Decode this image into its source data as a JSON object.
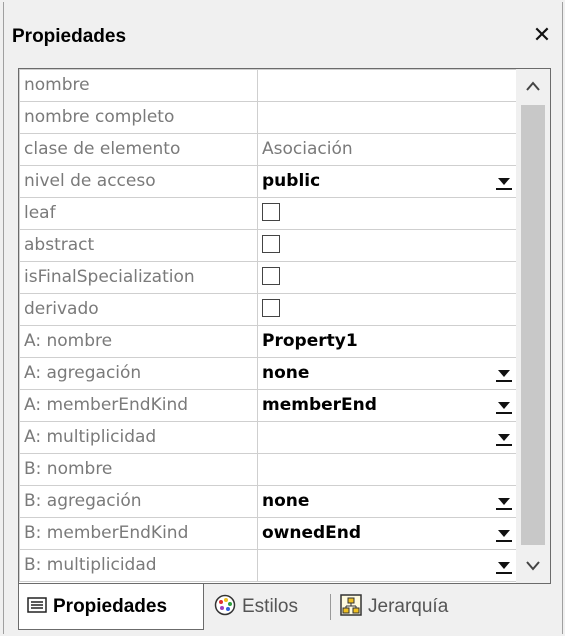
{
  "panel": {
    "title": "Propiedades",
    "close_glyph": "✕"
  },
  "properties": [
    {
      "name": "nombre",
      "value": "",
      "kind": "text"
    },
    {
      "name": "nombre completo",
      "value": "",
      "kind": "text"
    },
    {
      "name": "clase de elemento",
      "value": "Asociación",
      "kind": "readonly"
    },
    {
      "name": "nivel de acceso",
      "value": "public",
      "kind": "dropdown"
    },
    {
      "name": "leaf",
      "value": "",
      "kind": "checkbox",
      "checked": false
    },
    {
      "name": "abstract",
      "value": "",
      "kind": "checkbox",
      "checked": false
    },
    {
      "name": "isFinalSpecialization",
      "value": "",
      "kind": "checkbox",
      "checked": false
    },
    {
      "name": "derivado",
      "value": "",
      "kind": "checkbox",
      "checked": false
    },
    {
      "name": "A: nombre",
      "value": "Property1",
      "kind": "text"
    },
    {
      "name": "A: agregación",
      "value": "none",
      "kind": "dropdown"
    },
    {
      "name": "A: memberEndKind",
      "value": "memberEnd",
      "kind": "dropdown"
    },
    {
      "name": "A: multiplicidad",
      "value": "",
      "kind": "dropdown"
    },
    {
      "name": "B: nombre",
      "value": "",
      "kind": "text"
    },
    {
      "name": "B: agregación",
      "value": "none",
      "kind": "dropdown"
    },
    {
      "name": "B: memberEndKind",
      "value": "ownedEnd",
      "kind": "dropdown"
    },
    {
      "name": "B: multiplicidad",
      "value": "",
      "kind": "dropdown"
    }
  ],
  "scrollbar": {
    "up_glyph": "^",
    "down_glyph": "v"
  },
  "tabs": [
    {
      "label": "Propiedades",
      "icon": "properties-list-icon",
      "active": true
    },
    {
      "label": "Estilos",
      "icon": "palette-icon",
      "active": false
    },
    {
      "label": "Jerarquía",
      "icon": "hierarchy-icon",
      "active": false
    }
  ]
}
